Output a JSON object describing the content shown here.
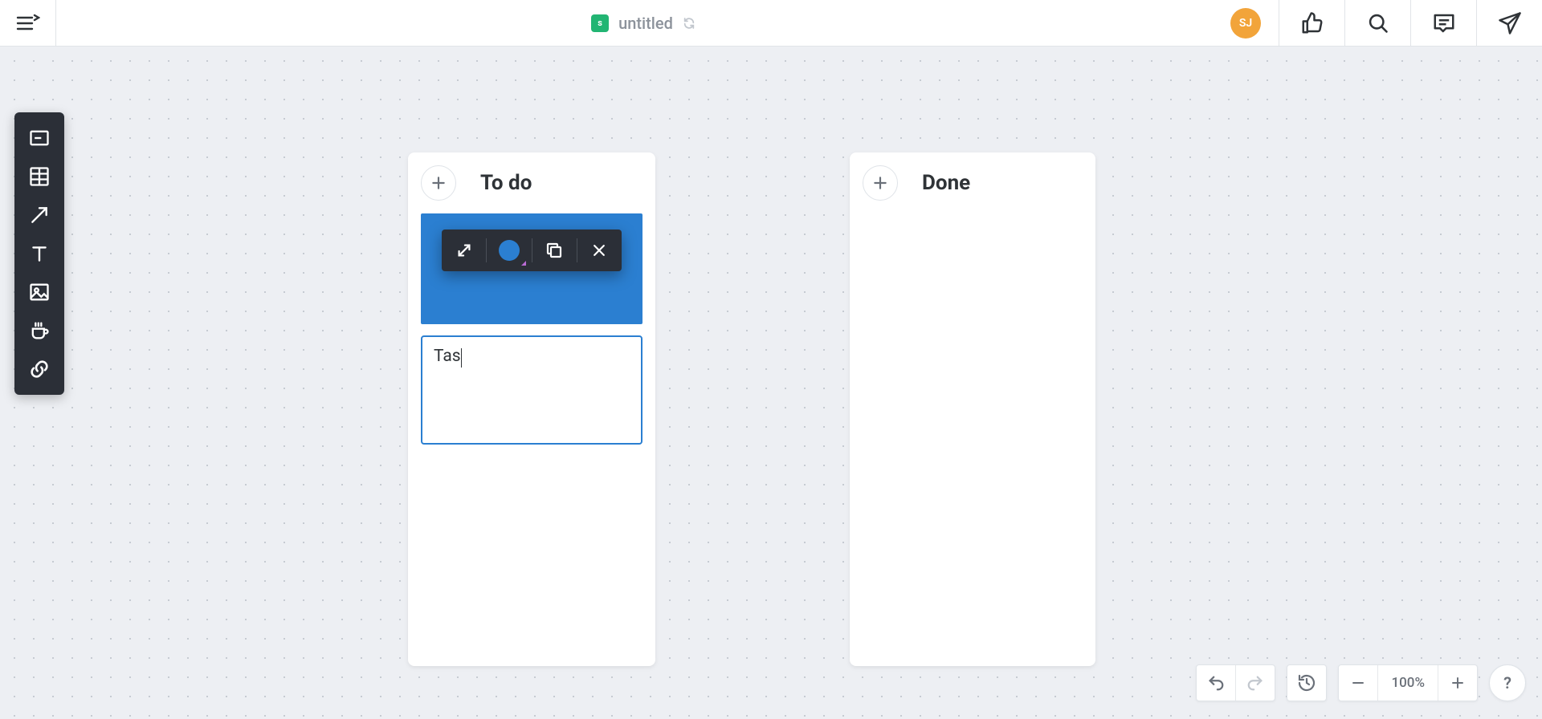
{
  "header": {
    "doc_badge": "s",
    "title": "untitled",
    "avatar_initials": "SJ"
  },
  "lists": {
    "todo": {
      "title": "To do"
    },
    "done": {
      "title": "Done"
    }
  },
  "editing_card": {
    "text": "Tas"
  },
  "card_popover": {
    "color": "#2b7fd1"
  },
  "zoom": {
    "label": "100%"
  },
  "help_label": "?"
}
